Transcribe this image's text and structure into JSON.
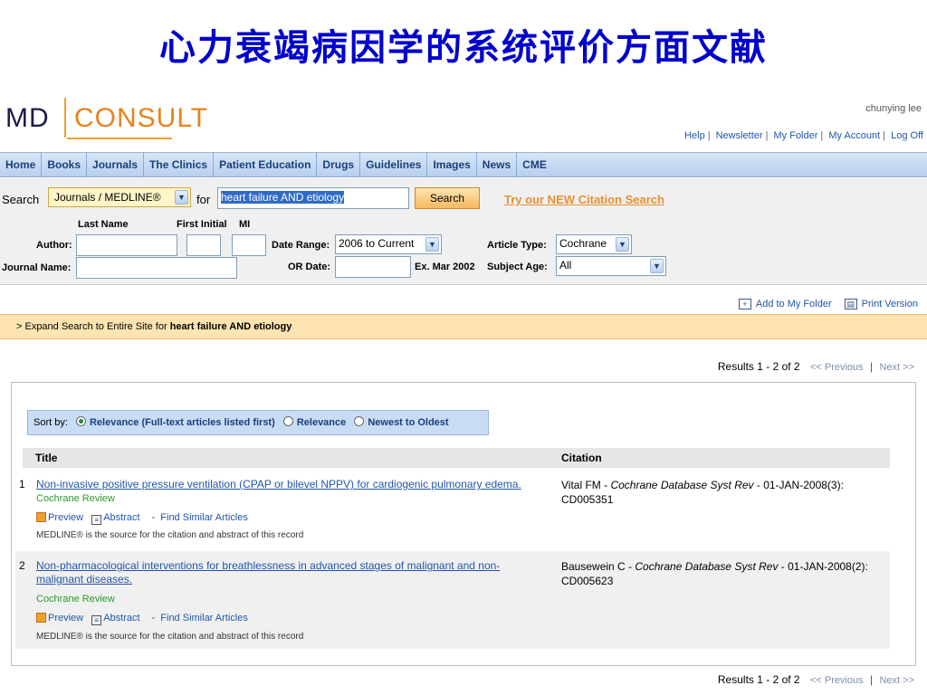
{
  "slide": {
    "title": "心力衰竭病因学的系统评价方面文献"
  },
  "header": {
    "logo_md": "MD",
    "logo_consult": "CONSULT",
    "user": "chunying lee",
    "links": [
      "Help",
      "Newsletter",
      "My Folder",
      "My Account",
      "Log Off"
    ]
  },
  "nav": [
    "Home",
    "Books",
    "Journals",
    "The Clinics",
    "Patient Education",
    "Drugs",
    "Guidelines",
    "Images",
    "News",
    "CME"
  ],
  "search": {
    "search_label": "Search",
    "scope": "Journals / MEDLINE®",
    "for_label": "for",
    "query": "heart failure  AND etiology",
    "button": "Search",
    "try_link": "Try our NEW Citation Search",
    "last_name_label": "Last Name",
    "first_initial_label": "First Initial",
    "mi_label": "MI",
    "author_label": "Author:",
    "journal_name_label": "Journal Name:",
    "date_range_label": "Date Range:",
    "date_range_value": "2006 to Current",
    "or_date_label": "OR Date:",
    "date_example": "Ex. Mar 2002",
    "article_type_label": "Article Type:",
    "article_type_value": "Cochrane",
    "subject_age_label": "Subject Age:",
    "subject_age_value": "All"
  },
  "actions": {
    "add_folder": "Add to My Folder",
    "print": "Print Version"
  },
  "expand": {
    "prefix": "> Expand Search to Entire Site for",
    "query": "heart failure AND etiology"
  },
  "results": {
    "summary": "Results 1 - 2 of 2",
    "previous": "<< Previous",
    "next": "Next >>",
    "sort_label": "Sort by:",
    "sort_options": [
      "Relevance (Full-text articles listed first)",
      "Relevance",
      "Newest to Oldest"
    ],
    "col_title": "Title",
    "col_citation": "Citation",
    "items": [
      {
        "num": "1",
        "title": "Non-invasive positive pressure ventilation (CPAP or bilevel NPPV) for cardiogenic pulmonary edema.",
        "source": "Cochrane Review",
        "preview": "Preview",
        "abstract": "Abstract",
        "similar": "Find Similar Articles",
        "note": "MEDLINE® is the source for the citation and abstract of this record",
        "author": "Vital FM - ",
        "journal": "Cochrane Database Syst Rev",
        "cite_rest": " - 01-JAN-2008(3): CD005351"
      },
      {
        "num": "2",
        "title": "Non-pharmacological interventions for breathlessness in advanced stages of malignant and non-malignant diseases.",
        "source": "Cochrane Review",
        "preview": "Preview",
        "abstract": "Abstract",
        "similar": "Find Similar Articles",
        "note": "MEDLINE® is the source for the citation and abstract of this record",
        "author": "Bausewein C - ",
        "journal": "Cochrane Database Syst Rev",
        "cite_rest": " - 01-JAN-2008(2): CD005623"
      }
    ]
  }
}
